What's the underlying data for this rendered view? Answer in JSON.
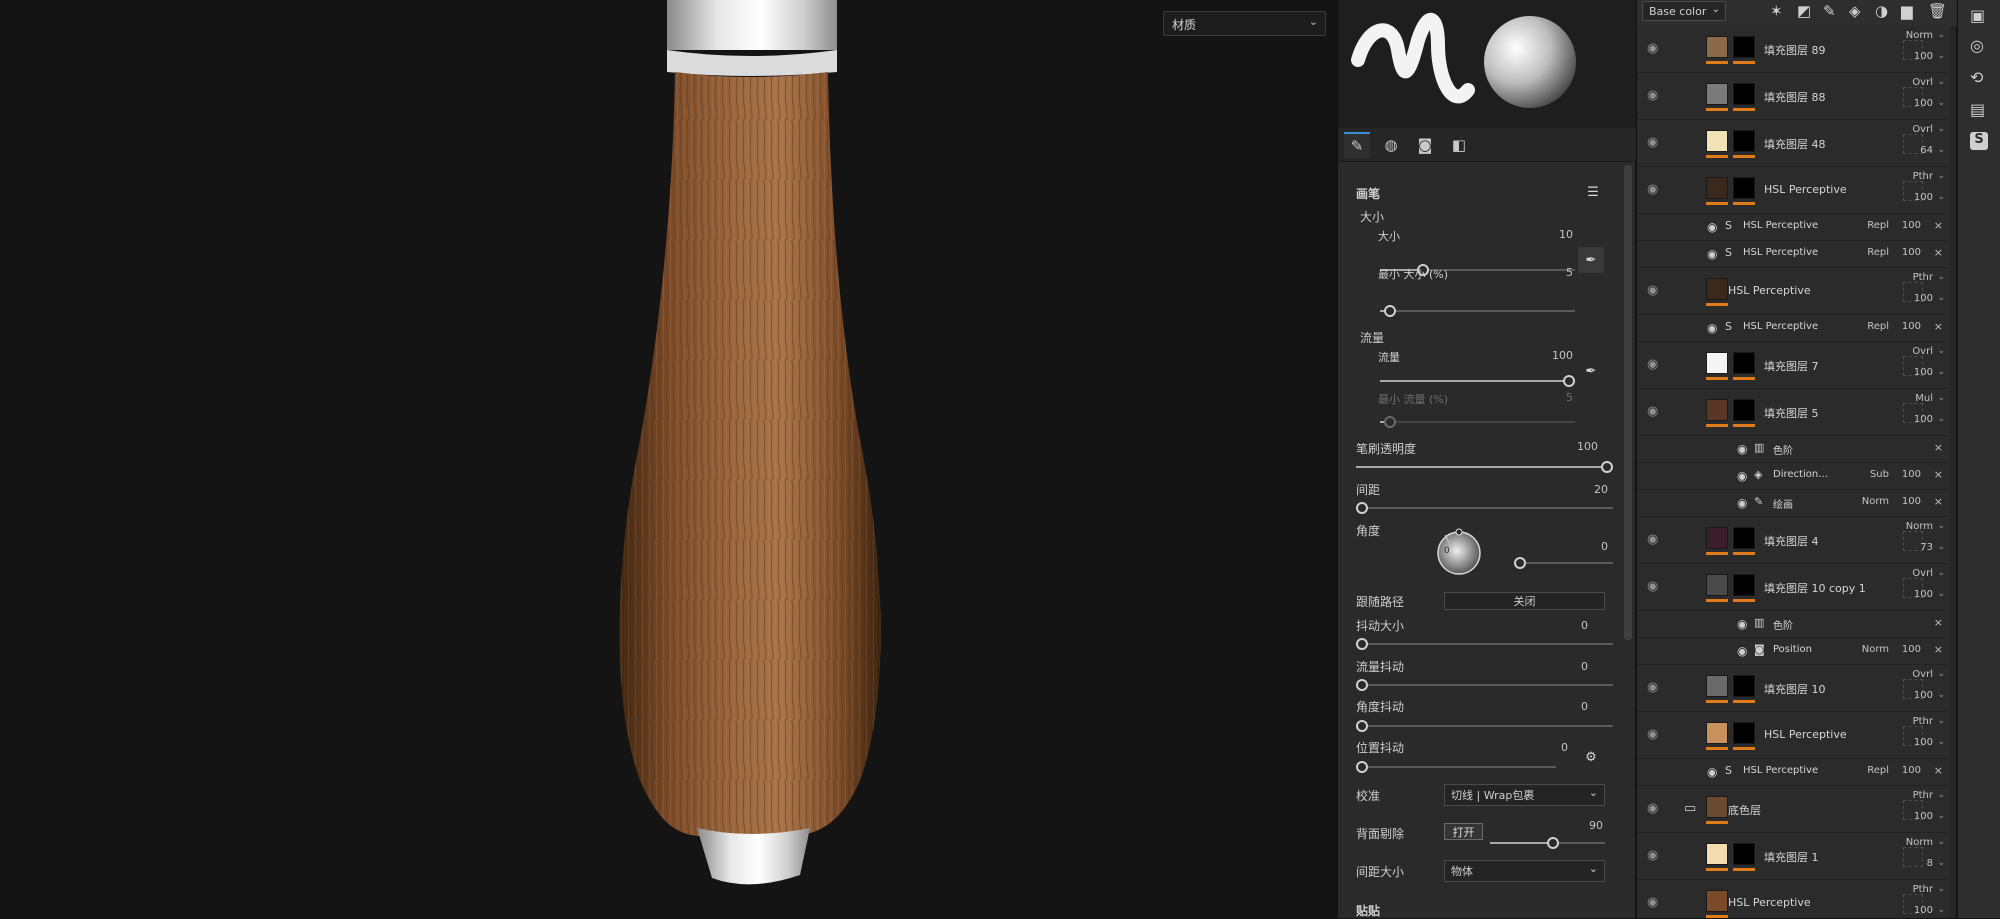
{
  "viewport": {
    "material_select": "材质"
  },
  "brush_tabs": [
    "brush-tab",
    "alpha-tab",
    "stencil-tab",
    "material-tab"
  ],
  "brush": {
    "section_title": "画笔",
    "size_group": "大小",
    "size_label": "大小",
    "size_value": "10",
    "size_level": 0.22,
    "min_size_label": "最小 大小 (%)",
    "min_size_value": "5",
    "min_size_level": 0.05,
    "flow_group": "流量",
    "flow_label": "流量",
    "flow_value": "100",
    "flow_level": 1.0,
    "min_flow_label": "最小 流量 (%)",
    "min_flow_value": "5",
    "min_flow_level": 0.05,
    "opacity_label": "笔刷透明度",
    "opacity_value": "100",
    "opacity_level": 1.0,
    "spacing_label": "间距",
    "spacing_value": "20",
    "spacing_level": 0.02,
    "angle_label": "角度",
    "angle_value": "0",
    "angle_dial_value": "0",
    "follow_path_label": "跟随路径",
    "follow_path_value": "关闭",
    "size_jitter_label": "抖动大小",
    "size_jitter_value": "0",
    "flow_jitter_label": "流量抖动",
    "flow_jitter_value": "0",
    "angle_jitter_label": "角度抖动",
    "angle_jitter_value": "0",
    "position_jitter_label": "位置抖动",
    "position_jitter_value": "0",
    "alignment_label": "校准",
    "alignment_value": "切线 | Wrap包裹",
    "backface_label": "背面剔除",
    "backface_button": "打开",
    "backface_value": "90",
    "backface_level": 0.55,
    "spacing_size_label": "间距大小",
    "spacing_size_value": "物体",
    "next_section": "贴贴"
  },
  "layers": {
    "channel": "Base color",
    "rows": [
      {
        "kind": "layer",
        "name": "填充图层 89",
        "blend": "Norm",
        "opacity": "100",
        "thumb": "#8a6a4a"
      },
      {
        "kind": "layer",
        "name": "填充图层 88",
        "blend": "Ovrl",
        "opacity": "100",
        "thumb": "#7a7a7a"
      },
      {
        "kind": "layer",
        "name": "填充图层 48",
        "blend": "Ovrl",
        "opacity": "64",
        "thumb": "#f2e2b8"
      },
      {
        "kind": "layer",
        "name": "HSL Perceptive",
        "blend": "Pthr",
        "opacity": "100",
        "thumb": "#3a2a1e"
      },
      {
        "kind": "effect",
        "name": "HSL Perceptive",
        "blend": "Repl",
        "opacity": "100"
      },
      {
        "kind": "effect",
        "name": "HSL Perceptive",
        "blend": "Repl",
        "opacity": "100"
      },
      {
        "kind": "layer-nomask",
        "name": "HSL Perceptive",
        "blend": "Pthr",
        "opacity": "100",
        "thumb": "#3a2a1e"
      },
      {
        "kind": "effect",
        "name": "HSL Perceptive",
        "blend": "Repl",
        "opacity": "100"
      },
      {
        "kind": "layer",
        "name": "填充图层 7",
        "blend": "Ovrl",
        "opacity": "100",
        "thumb": "#f4f4f4"
      },
      {
        "kind": "layer",
        "name": "填充图层 5",
        "blend": "Mul",
        "opacity": "100",
        "thumb": "#5a3626"
      },
      {
        "kind": "mask-effect",
        "name": "色阶",
        "blend": "",
        "opacity": ""
      },
      {
        "kind": "mask-effect",
        "name": "Direction…",
        "blend": "Sub",
        "opacity": "100"
      },
      {
        "kind": "mask-effect",
        "name": "绘画",
        "blend": "Norm",
        "opacity": "100"
      },
      {
        "kind": "layer",
        "name": "填充图层 4",
        "blend": "Norm",
        "opacity": "73",
        "thumb": "#3a1e2a"
      },
      {
        "kind": "layer",
        "name": "填充图层 10 copy 1",
        "blend": "Ovrl",
        "opacity": "100",
        "thumb": "#4a4a4a"
      },
      {
        "kind": "mask-effect",
        "name": "色阶",
        "blend": "",
        "opacity": ""
      },
      {
        "kind": "mask-effect",
        "name": "Position",
        "blend": "Norm",
        "opacity": "100"
      },
      {
        "kind": "layer",
        "name": "填充图层 10",
        "blend": "Ovrl",
        "opacity": "100",
        "thumb": "#6a6a6a"
      },
      {
        "kind": "layer",
        "name": "HSL Perceptive",
        "blend": "Pthr",
        "opacity": "100",
        "thumb": "#c8915e"
      },
      {
        "kind": "effect",
        "name": "HSL Perceptive",
        "blend": "Repl",
        "opacity": "100"
      },
      {
        "kind": "folder",
        "name": "底色层",
        "blend": "Pthr",
        "opacity": "100",
        "thumb": "#6a4a30"
      },
      {
        "kind": "layer",
        "name": "填充图层 1",
        "blend": "Norm",
        "opacity": "8",
        "thumb": "#f2dcb0"
      },
      {
        "kind": "layer-nomask",
        "name": "HSL Perceptive",
        "blend": "Pthr",
        "opacity": "100",
        "thumb": "#7a4a2a"
      }
    ]
  },
  "right_bar": [
    "viewport-settings-icon",
    "environment-icon",
    "history-icon",
    "log-icon",
    "substance-icon"
  ],
  "colors": {
    "accent": "#e07b1a",
    "tab_active": "#3b8bd9"
  }
}
